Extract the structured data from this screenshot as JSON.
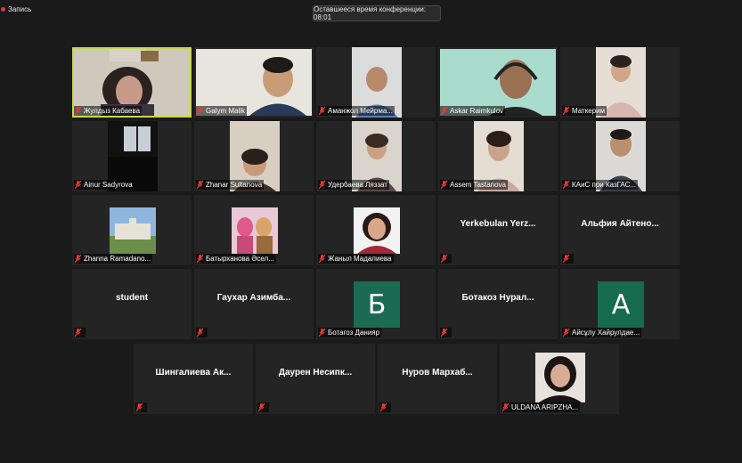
{
  "recording": {
    "label": "Запись"
  },
  "timer": {
    "text": "Оставшееся время конференции: 08:01"
  },
  "participants": [
    {
      "name": "Жулдыз Кабаева"
    },
    {
      "name": "Galym Malik"
    },
    {
      "name": "Аманжол Мейрма..."
    },
    {
      "name": "Askar Raimkulov"
    },
    {
      "name": "Маткерим"
    },
    {
      "name": "Ainur Sadyrova"
    },
    {
      "name": "Zhanar Sultanova"
    },
    {
      "name": "Удербаева Ляззат"
    },
    {
      "name": "Assem Tastanova"
    },
    {
      "name": "КАиС при КазГАС..."
    },
    {
      "name": "Zhanna Ramadano..."
    },
    {
      "name": "Батырханова Әсел..."
    },
    {
      "name": "Жаныл Мадалиева"
    },
    {
      "name": "",
      "display": "Yerkebulan  Yerz..."
    },
    {
      "name": "",
      "display": "Альфия  Айтено..."
    },
    {
      "name": "",
      "display": "student"
    },
    {
      "name": "",
      "display": "Гаухар  Азимба..."
    },
    {
      "name": "Ботагоз Данияр",
      "initial": "Б",
      "initial_color": "#1b6a52"
    },
    {
      "name": "",
      "display": "Ботакоз  Нурал..."
    },
    {
      "name": "Айсұлу Хайрулдае...",
      "initial": "A",
      "initial_color": "#176b4f"
    },
    {
      "name": "",
      "display": "Шингалиева  Ак..."
    },
    {
      "name": "",
      "display": "Даурен  Несипк..."
    },
    {
      "name": "",
      "display": "Нуров  Мархаб..."
    },
    {
      "name": "ULDANA ARIPZHA..."
    }
  ]
}
